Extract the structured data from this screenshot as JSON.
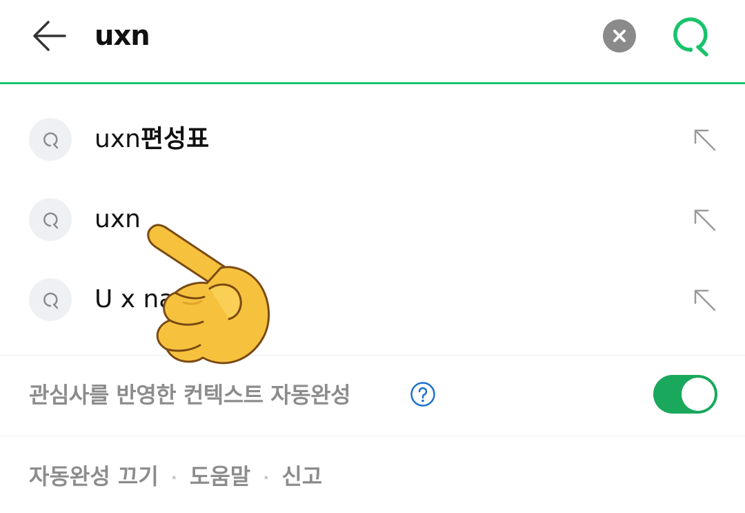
{
  "search": {
    "query": "uxn"
  },
  "suggestions": [
    {
      "prefix": "uxn",
      "suffix": "편성표"
    },
    {
      "prefix": "uxn",
      "suffix": ""
    },
    {
      "prefix": "U x na",
      "suffix": ""
    }
  ],
  "context_autocomplete": {
    "label": "관심사를 반영한 컨텍스트 자동완성",
    "enabled": true
  },
  "footer": {
    "links": [
      "자동완성 끄기",
      "도움말",
      "신고"
    ],
    "separator": "·"
  },
  "colors": {
    "accent": "#19c36b",
    "toggle_on": "#19a85c",
    "help": "#1a6fd1"
  },
  "icons": [
    "back-arrow-icon",
    "clear-icon",
    "search-icon",
    "insert-arrow-icon",
    "help-icon",
    "pointing-hand-emoji"
  ]
}
